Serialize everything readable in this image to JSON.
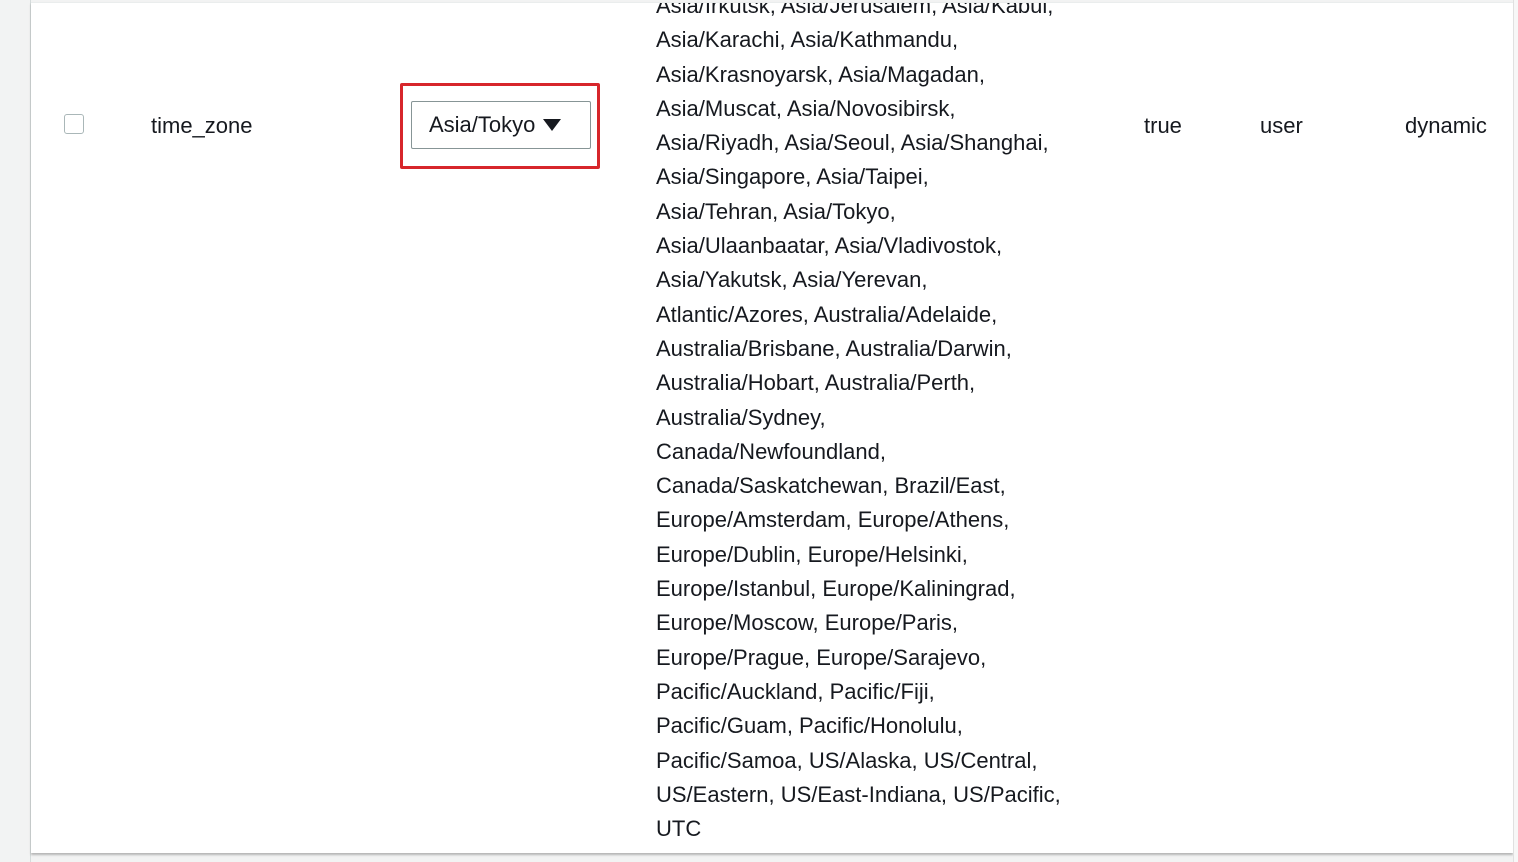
{
  "row": {
    "name": "time_zone",
    "selected_value": "Asia/Tokyo",
    "allowed_values_lines": [
      "Asia/Irkutsk, Asia/Jerusalem, Asia/Kabul,",
      "Asia/Karachi, Asia/Kathmandu,",
      "Asia/Krasnoyarsk, Asia/Magadan,",
      "Asia/Muscat, Asia/Novosibirsk,",
      "Asia/Riyadh, Asia/Seoul, Asia/Shanghai,",
      "Asia/Singapore, Asia/Taipei,",
      "Asia/Tehran, Asia/Tokyo,",
      "Asia/Ulaanbaatar, Asia/Vladivostok,",
      "Asia/Yakutsk, Asia/Yerevan,",
      "Atlantic/Azores, Australia/Adelaide,",
      "Australia/Brisbane, Australia/Darwin,",
      "Australia/Hobart, Australia/Perth,",
      "Australia/Sydney,",
      "Canada/Newfoundland,",
      "Canada/Saskatchewan, Brazil/East,",
      "Europe/Amsterdam, Europe/Athens,",
      "Europe/Dublin, Europe/Helsinki,",
      "Europe/Istanbul, Europe/Kaliningrad,",
      "Europe/Moscow, Europe/Paris,",
      "Europe/Prague, Europe/Sarajevo,",
      "Pacific/Auckland, Pacific/Fiji,",
      "Pacific/Guam, Pacific/Honolulu,",
      "Pacific/Samoa, US/Alaska, US/Central,",
      "US/Eastern, US/East-Indiana, US/Pacific,",
      "UTC"
    ],
    "is_modifiable": "true",
    "source": "user",
    "apply_type": "dynamic"
  },
  "colors": {
    "highlight": "#d7262b",
    "text": "#16191f",
    "border": "#879596"
  },
  "icons": {
    "select_caret": "caret-down-icon"
  }
}
